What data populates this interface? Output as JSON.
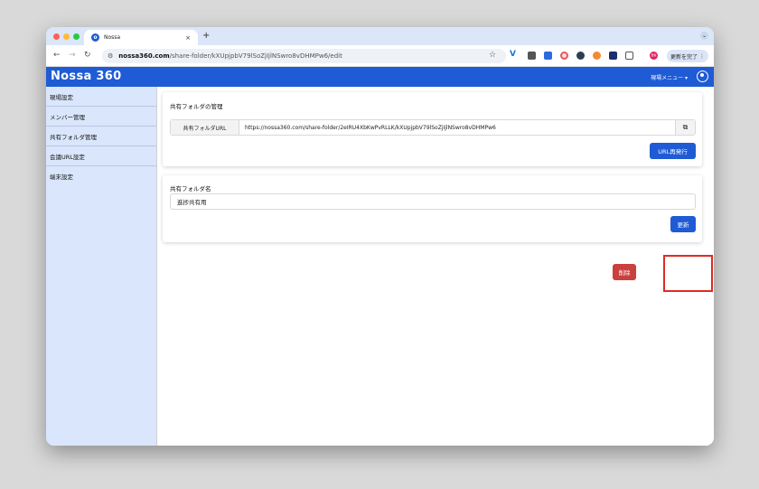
{
  "browser": {
    "tab_title": "Nossa",
    "tab_close": "×",
    "new_tab": "+",
    "url_domain": "nossa360.com",
    "url_path": "/share-folder/kXUpjpbV79lSoZjIjlNSwro8vDHMPw6/edit",
    "update_button": "更新を完了",
    "update_badge": "更新"
  },
  "header": {
    "logo": "Nossa 360",
    "site_menu": "現場メニュー ▾"
  },
  "sidebar": {
    "items": [
      {
        "label": "現場設定"
      },
      {
        "label": "メンバー管理"
      },
      {
        "label": "共有フォルダ管理"
      },
      {
        "label": "会議URL設定"
      },
      {
        "label": "端末設定"
      }
    ]
  },
  "share_card": {
    "title": "共有フォルダの管理",
    "url_label": "共有フォルダURL",
    "url_value": "https://nossa360.com/share-folder/2eIRU4XbKwPvRLLK/kXUpjpbV79lSoZjIjlNSwro8vDHMPw6",
    "reissue_button": "URL再発行"
  },
  "name_card": {
    "title": "共有フォルダ名",
    "name_value": "進捗共有用",
    "update_button": "更新"
  },
  "delete_button": "削除",
  "colors": {
    "brand": "#1f5bd4",
    "danger": "#c9403f",
    "highlight": "#e02a21"
  }
}
